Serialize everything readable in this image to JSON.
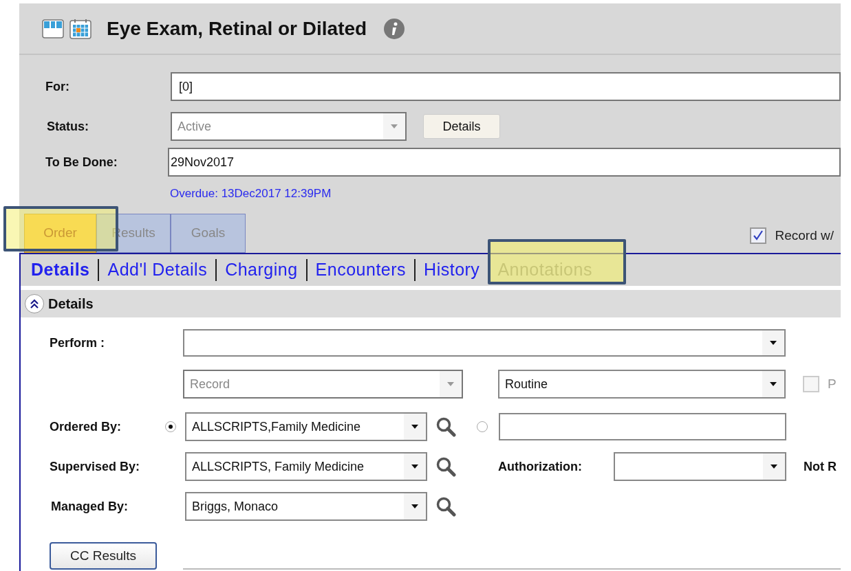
{
  "header": {
    "title": "Eye Exam, Retinal or Dilated"
  },
  "form": {
    "for_field": {
      "label": "For:",
      "value": "[0]"
    },
    "status": {
      "label": "Status:",
      "value": "Active",
      "disabled": true
    },
    "details_button": "Details",
    "to_be_done": {
      "label": "To Be Done:",
      "value": "29Nov2017"
    },
    "overdue": "Overdue: 13Dec2017 12:39PM"
  },
  "tabs": [
    {
      "label": "Order",
      "selected": true
    },
    {
      "label": "Results",
      "selected": false
    },
    {
      "label": "Goals",
      "selected": false
    }
  ],
  "record_checkbox": {
    "label": "Record w/",
    "checked": true
  },
  "subtabs": [
    {
      "label": "Details",
      "selected": true,
      "disabled": false
    },
    {
      "label": "Add'l Details",
      "selected": false,
      "disabled": false
    },
    {
      "label": "Charging",
      "selected": false,
      "disabled": false
    },
    {
      "label": "Encounters",
      "selected": false,
      "disabled": false
    },
    {
      "label": "History",
      "selected": false,
      "disabled": false
    },
    {
      "label": "Annotations",
      "selected": false,
      "disabled": true
    }
  ],
  "section": {
    "title": "Details",
    "expanded": true
  },
  "details": {
    "perform": {
      "label": "Perform :"
    },
    "record_select": {
      "value": "Record",
      "disabled": true
    },
    "routine_select": {
      "value": "Routine",
      "disabled": false
    },
    "pr_checkbox": {
      "label": "P",
      "checked": false,
      "disabled": true
    },
    "ordered_by": {
      "label": "Ordered By:",
      "options": [
        {
          "selected": true,
          "value": "ALLSCRIPTS,Family Medicine"
        },
        {
          "selected": false
        }
      ]
    },
    "supervised_by": {
      "label": "Supervised By:",
      "value": "ALLSCRIPTS, Family Medicine"
    },
    "authorization": {
      "label": "Authorization:"
    },
    "not_r": "Not R",
    "managed_by": {
      "label": "Managed By:",
      "value": "Briggs, Monaco"
    },
    "cc_button": "CC Results"
  }
}
